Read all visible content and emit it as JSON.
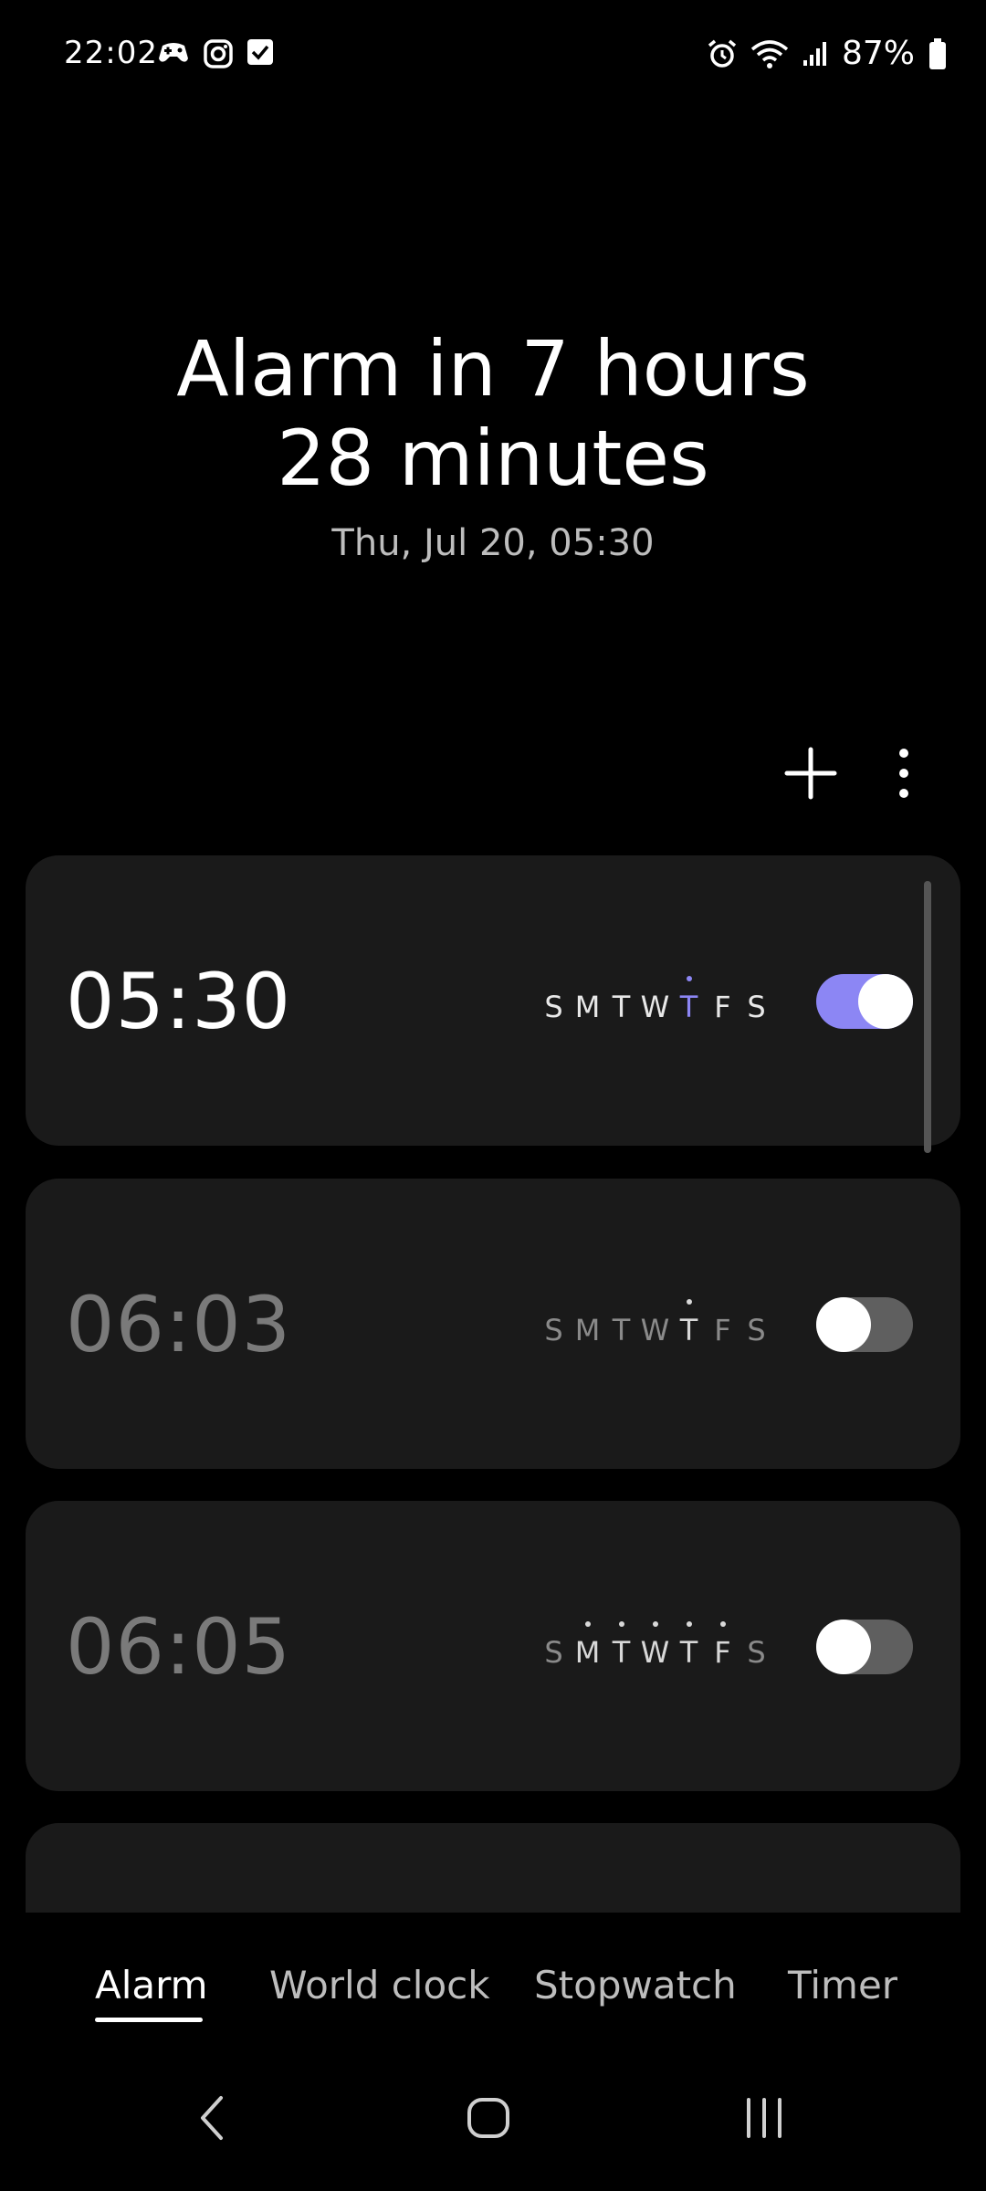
{
  "status_bar": {
    "time": "22:02",
    "battery_text": "87%",
    "left_icons": [
      "game-controller-icon",
      "instagram-icon",
      "checkbox-icon"
    ],
    "right_icons": [
      "alarm-clock-icon",
      "wifi-icon",
      "signal-icon",
      "battery-icon"
    ]
  },
  "header": {
    "headline_line1": "Alarm in 7 hours",
    "headline_line2": "28 minutes",
    "next_alarm": "Thu, Jul 20, 05:30"
  },
  "toolbar": {
    "add_icon": "plus-icon",
    "more_icon": "more-vertical-icon"
  },
  "alarms": [
    {
      "time": "05:30",
      "enabled": true,
      "days": [
        {
          "letter": "S",
          "dot": false
        },
        {
          "letter": "M",
          "dot": false
        },
        {
          "letter": "T",
          "dot": false
        },
        {
          "letter": "W",
          "dot": false
        },
        {
          "letter": "T",
          "dot": true
        },
        {
          "letter": "F",
          "dot": false
        },
        {
          "letter": "S",
          "dot": false
        }
      ]
    },
    {
      "time": "06:03",
      "enabled": false,
      "days": [
        {
          "letter": "S",
          "dot": false
        },
        {
          "letter": "M",
          "dot": false
        },
        {
          "letter": "T",
          "dot": false
        },
        {
          "letter": "W",
          "dot": false
        },
        {
          "letter": "T",
          "dot": true
        },
        {
          "letter": "F",
          "dot": false
        },
        {
          "letter": "S",
          "dot": false
        }
      ]
    },
    {
      "time": "06:05",
      "enabled": false,
      "days": [
        {
          "letter": "S",
          "dot": false
        },
        {
          "letter": "M",
          "dot": true
        },
        {
          "letter": "T",
          "dot": true
        },
        {
          "letter": "W",
          "dot": true
        },
        {
          "letter": "T",
          "dot": true
        },
        {
          "letter": "F",
          "dot": true
        },
        {
          "letter": "S",
          "dot": false
        }
      ]
    }
  ],
  "tabs": [
    {
      "label": "Alarm",
      "active": true
    },
    {
      "label": "World clock",
      "active": false
    },
    {
      "label": "Stopwatch",
      "active": false
    },
    {
      "label": "Timer",
      "active": false
    }
  ],
  "nav_bar": {
    "icons": [
      "back-icon",
      "home-icon",
      "recents-icon"
    ]
  },
  "colors": {
    "accent": "#8c86f4",
    "card": "#1a1a1a",
    "background": "#000000"
  }
}
